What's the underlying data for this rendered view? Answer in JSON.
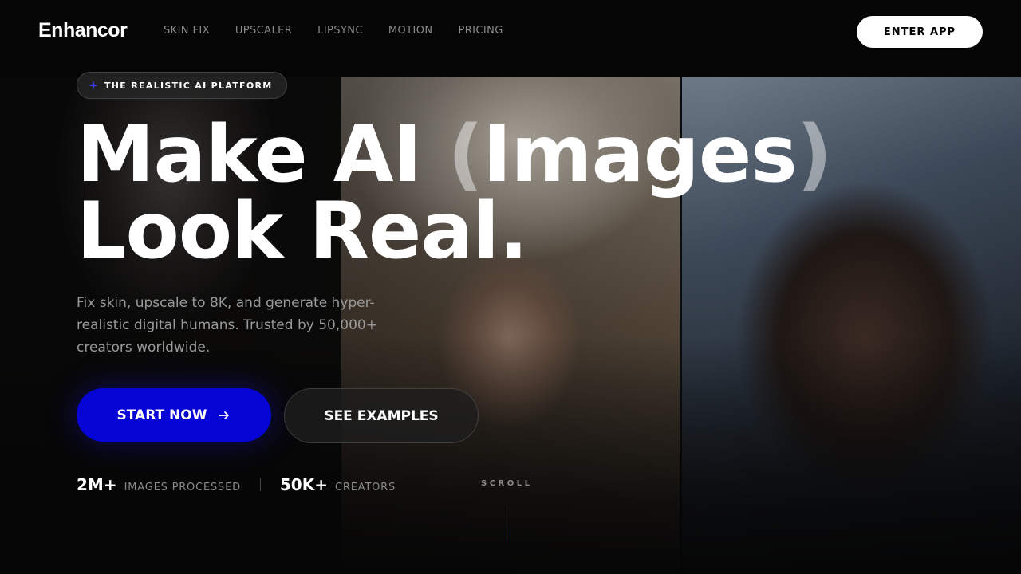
{
  "nav": {
    "logo": "Enhancor",
    "links": [
      "SKIN FIX",
      "UPSCALER",
      "LIPSYNC",
      "MOTION",
      "PRICING"
    ],
    "cta": "ENTER APP"
  },
  "hero": {
    "badge": {
      "icon": "sparkles-icon",
      "text": "THE REALISTIC AI PLATFORM"
    },
    "headline": {
      "line1_pre": "Make AI ",
      "paren_open": "(",
      "line1_word": "Images",
      "paren_close": ")",
      "line2": "Look Real."
    },
    "subtext": "Fix skin, upscale to 8K, and generate hyper-realistic digital humans. Trusted by 50,000+ creators worldwide.",
    "primary_button": {
      "label": "START NOW",
      "icon": "arrow-right-icon"
    },
    "secondary_button": {
      "label": "SEE EXAMPLES"
    },
    "stats": [
      {
        "value": "2M+",
        "label": "IMAGES PROCESSED"
      },
      {
        "value": "50K+",
        "label": "CREATORS"
      }
    ],
    "scroll_label": "SCROLL"
  },
  "colors": {
    "background": "#050505",
    "accent": "#0605d6",
    "muted_text": "#8a8a8a"
  }
}
